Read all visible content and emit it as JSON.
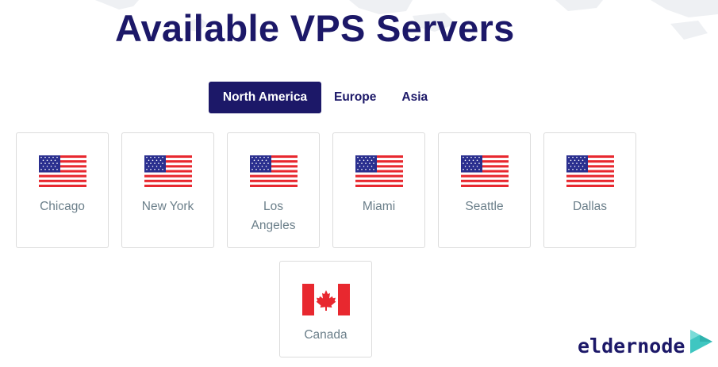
{
  "header": {
    "title": "Available VPS Servers"
  },
  "tabs": [
    {
      "label": "North America",
      "active": true
    },
    {
      "label": "Europe",
      "active": false
    },
    {
      "label": "Asia",
      "active": false
    }
  ],
  "locations": [
    {
      "city": "Chicago",
      "flag": "usa-flag-icon"
    },
    {
      "city": "New York",
      "flag": "usa-flag-icon"
    },
    {
      "city": "Los Angeles",
      "flag": "usa-flag-icon"
    },
    {
      "city": "Miami",
      "flag": "usa-flag-icon"
    },
    {
      "city": "Seattle",
      "flag": "usa-flag-icon"
    },
    {
      "city": "Dallas",
      "flag": "usa-flag-icon"
    },
    {
      "city": "Canada",
      "flag": "canada-flag-icon"
    }
  ],
  "logo": {
    "text": "eldernode",
    "icon": "play-triangle-icon"
  },
  "colors": {
    "brand_navy": "#1c1868",
    "city_text": "#6b7f8a",
    "card_border": "#dcdcdc",
    "logo_teal": "#3fc6c1",
    "flag_red": "#e8282f",
    "flag_blue": "#2a2f8f"
  }
}
